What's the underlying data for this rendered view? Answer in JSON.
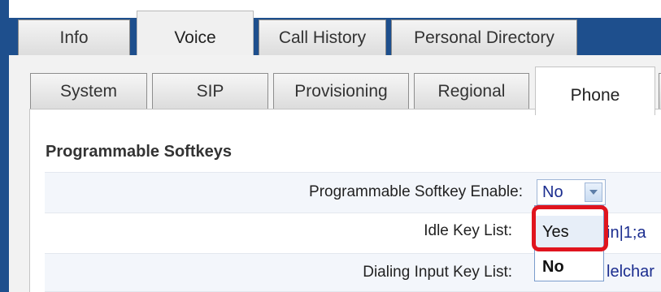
{
  "main_tabs": [
    {
      "label": "Info"
    },
    {
      "label": "Voice"
    },
    {
      "label": "Call History"
    },
    {
      "label": "Personal Directory"
    }
  ],
  "sub_tabs": [
    {
      "label": "System"
    },
    {
      "label": "SIP"
    },
    {
      "label": "Provisioning"
    },
    {
      "label": "Regional"
    },
    {
      "label": "Phone"
    }
  ],
  "section": {
    "title": "Programmable Softkeys"
  },
  "fields": {
    "softkey_enable": {
      "label": "Programmable Softkey Enable:",
      "value": "No"
    },
    "idle_key_list": {
      "label": "Idle Key List:",
      "value_fragment": "in|1;a"
    },
    "dialing_input_key_list": {
      "label": "Dialing Input Key List:",
      "value_fragment": "lelchar"
    }
  },
  "dropdown": {
    "options": [
      "Yes",
      "No"
    ],
    "hovered": "Yes",
    "selected": "No"
  },
  "icons": {
    "select_arrow": "chevron-down-icon"
  },
  "colors": {
    "chrome_blue": "#1e4f8d",
    "highlight_red": "#e0141e",
    "value_blue": "#1b2d8f"
  }
}
